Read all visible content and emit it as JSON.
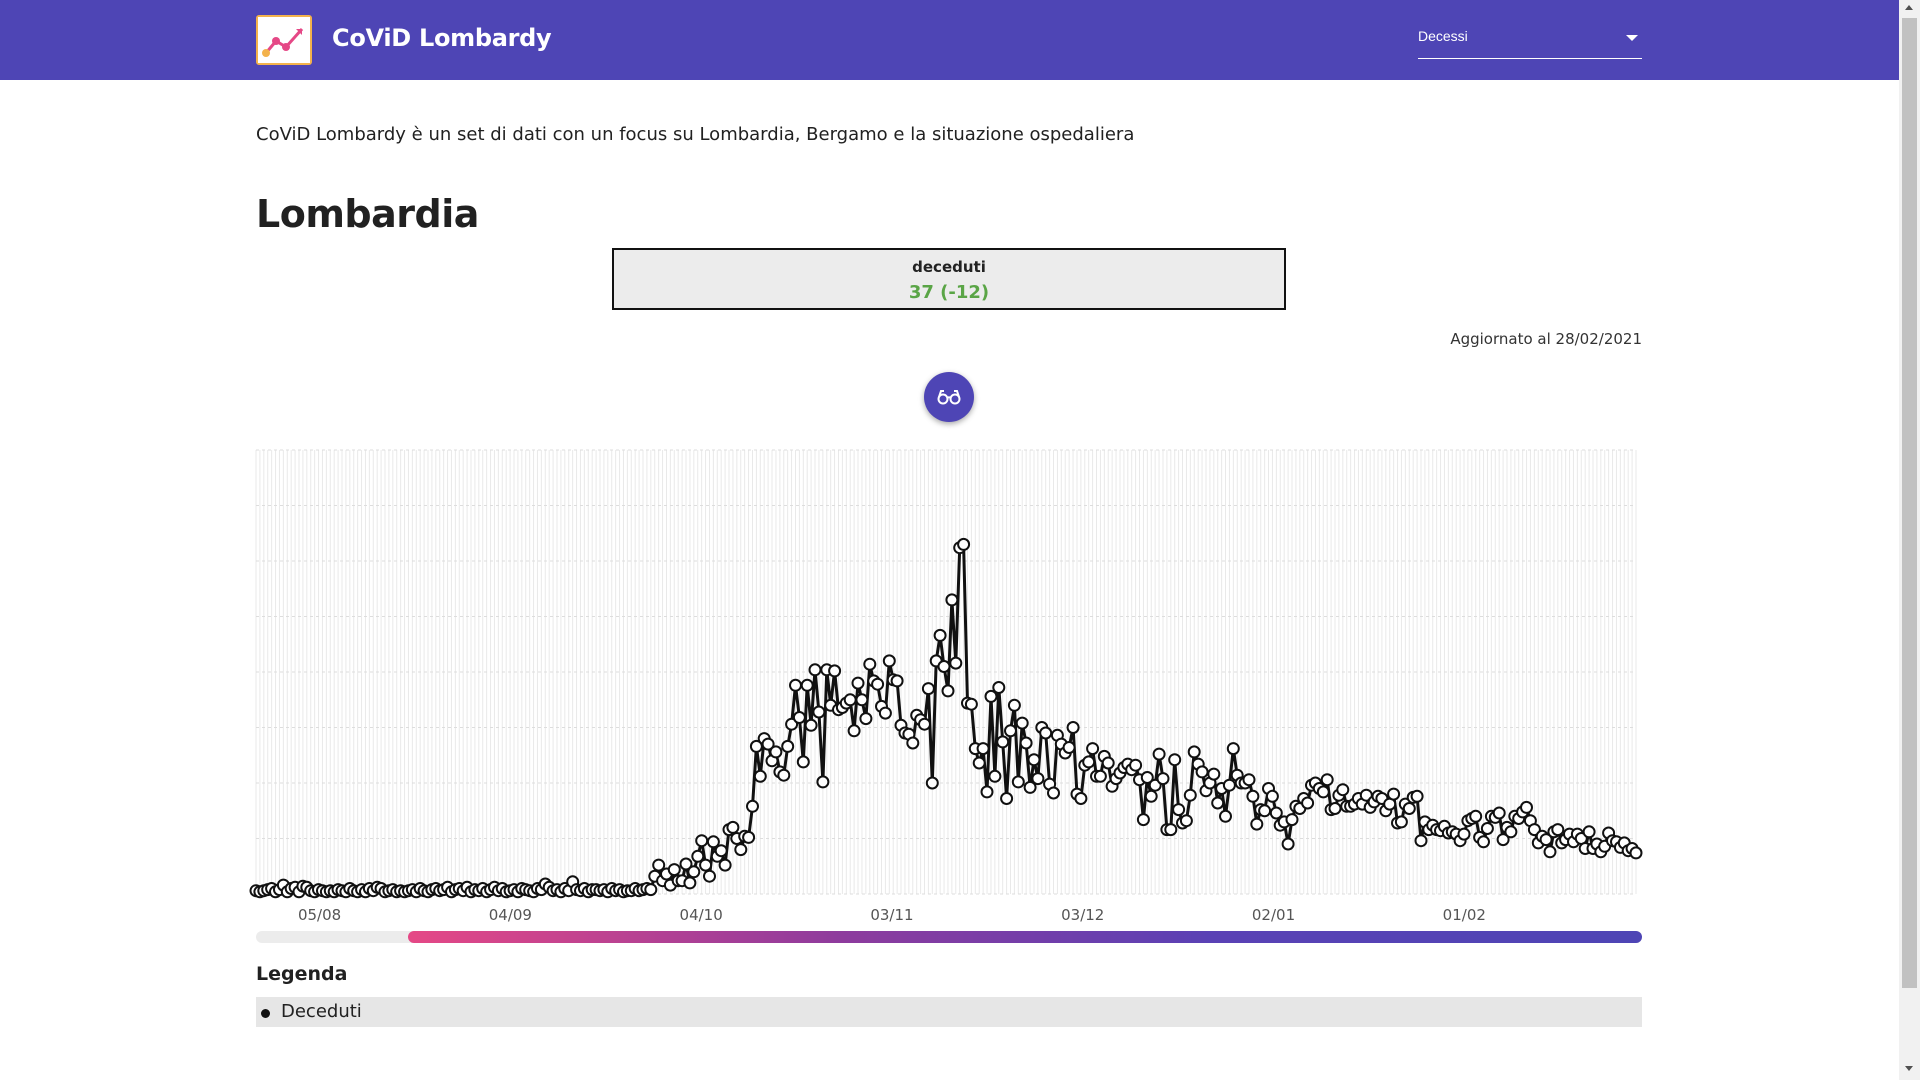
{
  "app": {
    "title": "CoViD Lombardy",
    "brand_color": "#4e45b5",
    "logo_icon": "line-chart-logo-icon"
  },
  "metric_select": {
    "selected": "Decessi"
  },
  "intro_text": "CoViD Lombardy è un set di dati con un focus su Lombardia, Bergamo e la situazione ospedaliera",
  "section": {
    "title": "Lombardia",
    "stat_label": "deceduti",
    "stat_value": "37 (-12)",
    "stat_value_color": "#5aa546",
    "updated": "Aggiornato al 28/02/2021"
  },
  "fab_icon": "glasses-icon",
  "chart_data": {
    "type": "line",
    "title": "",
    "xlabel": "",
    "ylabel": "",
    "x_ticks": [
      "05/08",
      "04/09",
      "04/10",
      "03/11",
      "03/12",
      "02/01",
      "01/02"
    ],
    "x_start": "2020-07-26",
    "x_end": "2021-02-28",
    "grid": true,
    "y_ticks_shown": false,
    "ylim": [
      0,
      400
    ],
    "series": [
      {
        "name": "Deceduti",
        "color": "#111111",
        "values": [
          3,
          2,
          3,
          4,
          5,
          2,
          4,
          8,
          2,
          5,
          6,
          2,
          7,
          6,
          3,
          2,
          4,
          3,
          2,
          3,
          2,
          4,
          3,
          2,
          5,
          3,
          2,
          4,
          2,
          5,
          3,
          6,
          5,
          2,
          3,
          4,
          2,
          3,
          2,
          3,
          4,
          2,
          5,
          3,
          2,
          4,
          5,
          3,
          4,
          6,
          2,
          4,
          5,
          3,
          6,
          2,
          4,
          3,
          5,
          2,
          4,
          6,
          3,
          5,
          2,
          3,
          4,
          2,
          5,
          4,
          3,
          2,
          5,
          4,
          9,
          6,
          3,
          4,
          2,
          5,
          3,
          11,
          4,
          3,
          5,
          2,
          4,
          4,
          3,
          4,
          2,
          5,
          3,
          4,
          2,
          3,
          3,
          5,
          3,
          4,
          5,
          4,
          16,
          26,
          12,
          18,
          8,
          22,
          12,
          12,
          27,
          10,
          20,
          34,
          48,
          26,
          16,
          47,
          34,
          39,
          26,
          58,
          60,
          50,
          40,
          52,
          51,
          79,
          133,
          106,
          140,
          135,
          120,
          128,
          110,
          107,
          133,
          153,
          188,
          159,
          119,
          188,
          152,
          202,
          164,
          101,
          202,
          170,
          201,
          166,
          168,
          172,
          175,
          147,
          190,
          175,
          158,
          207,
          192,
          189,
          169,
          163,
          210,
          193,
          192,
          152,
          145,
          144,
          136,
          161,
          157,
          153,
          185,
          100,
          210,
          233,
          205,
          183,
          265,
          208,
          312,
          315,
          172,
          171,
          131,
          118,
          131,
          92,
          178,
          106,
          186,
          137,
          86,
          147,
          170,
          101,
          154,
          136,
          96,
          121,
          104,
          150,
          145,
          99,
          91,
          143,
          135,
          127,
          132,
          150,
          90,
          86,
          116,
          119,
          131,
          106,
          106,
          124,
          118,
          97,
          104,
          109,
          114,
          117,
          112,
          116,
          103,
          67,
          105,
          88,
          98,
          126,
          104,
          58,
          58,
          121,
          76,
          64,
          66,
          89,
          128,
          117,
          110,
          93,
          100,
          108,
          82,
          95,
          70,
          98,
          131,
          107,
          100,
          100,
          103,
          88,
          63,
          76,
          75,
          95,
          88,
          73,
          62,
          65,
          45,
          67,
          79,
          77,
          86,
          82,
          98,
          100,
          95,
          92,
          103,
          76,
          77,
          89,
          94,
          79,
          79,
          81,
          86,
          81,
          89,
          78,
          83,
          88,
          86,
          75,
          81,
          90,
          64,
          65,
          81,
          77,
          87,
          88,
          48,
          65,
          58,
          62,
          58,
          57,
          61,
          55,
          56,
          54,
          48,
          54,
          66,
          68,
          70,
          51,
          47,
          59,
          70,
          69,
          73,
          49,
          60,
          56,
          70,
          68,
          74,
          78,
          66,
          58,
          46,
          52,
          49,
          38,
          56,
          58,
          46,
          49,
          54,
          47,
          54,
          50,
          41,
          56,
          41,
          45,
          38,
          43,
          55,
          48,
          47,
          42,
          46,
          39,
          41,
          37
        ]
      }
    ]
  },
  "range": {
    "start_fraction": 0.11,
    "end_fraction": 1.0
  },
  "legend": {
    "title": "Legenda",
    "items": [
      {
        "label": "Deceduti",
        "color": "#111111"
      }
    ]
  }
}
